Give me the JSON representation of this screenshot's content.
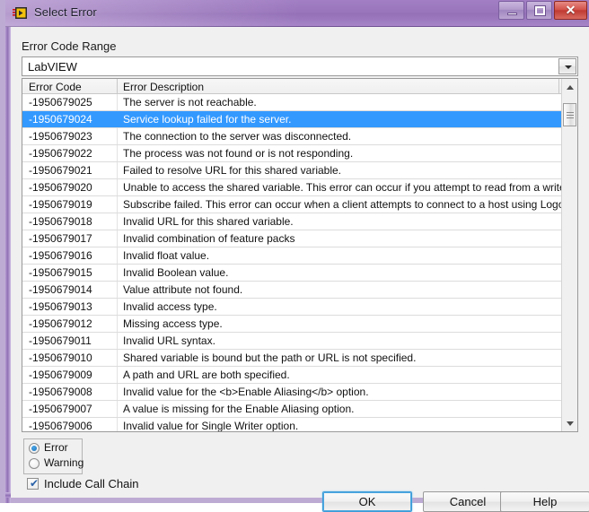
{
  "window": {
    "title": "Select Error",
    "icon": "labview-error-icon",
    "controls": {
      "minimize": "minimize-icon",
      "maximize": "restore-icon",
      "close": "✕"
    }
  },
  "form": {
    "range_label": "Error Code Range",
    "range_value": "LabVIEW",
    "dropdown_icon": "chevron-down-icon"
  },
  "list": {
    "columns": [
      "Error Code",
      "Error Description"
    ],
    "selected_index": 1,
    "rows": [
      {
        "code": "-1950679025",
        "desc": "The server is not reachable."
      },
      {
        "code": "-1950679024",
        "desc": "Service lookup failed for the server."
      },
      {
        "code": "-1950679023",
        "desc": "The connection to the server was disconnected."
      },
      {
        "code": "-1950679022",
        "desc": "The process was not found or is not responding."
      },
      {
        "code": "-1950679021",
        "desc": "Failed to resolve URL for this shared variable."
      },
      {
        "code": "-1950679020",
        "desc": "Unable to access the shared variable. This error can occur if you attempt to read from a write-"
      },
      {
        "code": "-1950679019",
        "desc": "Subscribe failed. This error can occur when a client attempts to connect to a host using Logos"
      },
      {
        "code": "-1950679018",
        "desc": "Invalid URL for this shared variable."
      },
      {
        "code": "-1950679017",
        "desc": "Invalid combination of feature packs"
      },
      {
        "code": "-1950679016",
        "desc": "Invalid float value."
      },
      {
        "code": "-1950679015",
        "desc": "Invalid Boolean value."
      },
      {
        "code": "-1950679014",
        "desc": "Value attribute not found."
      },
      {
        "code": "-1950679013",
        "desc": "Invalid access type."
      },
      {
        "code": "-1950679012",
        "desc": "Missing access type."
      },
      {
        "code": "-1950679011",
        "desc": "Invalid URL syntax."
      },
      {
        "code": "-1950679010",
        "desc": "Shared variable is bound but the path or URL is not specified."
      },
      {
        "code": "-1950679009",
        "desc": "A path and URL are both specified."
      },
      {
        "code": "-1950679008",
        "desc": "Invalid value for the <b>Enable Aliasing</b> option."
      },
      {
        "code": "-1950679007",
        "desc": "A value is missing for the Enable Aliasing option."
      },
      {
        "code": "-1950679006",
        "desc": "Invalid value for Single Writer option."
      }
    ],
    "scrollbar": {
      "up_icon": "triangle-up-icon",
      "down_icon": "triangle-down-icon"
    }
  },
  "options": {
    "type_error": "Error",
    "type_warning": "Warning",
    "selected_type": "Error",
    "include_call_chain_label": "Include Call Chain",
    "include_call_chain_checked": true,
    "check_glyph": "✔"
  },
  "buttons": {
    "ok": "OK",
    "cancel": "Cancel",
    "help": "Help"
  },
  "colors": {
    "titlebar": "#9470b7",
    "selection": "#3399ff",
    "close_button": "#bf3a32",
    "focus_border": "#3c9cd8"
  }
}
